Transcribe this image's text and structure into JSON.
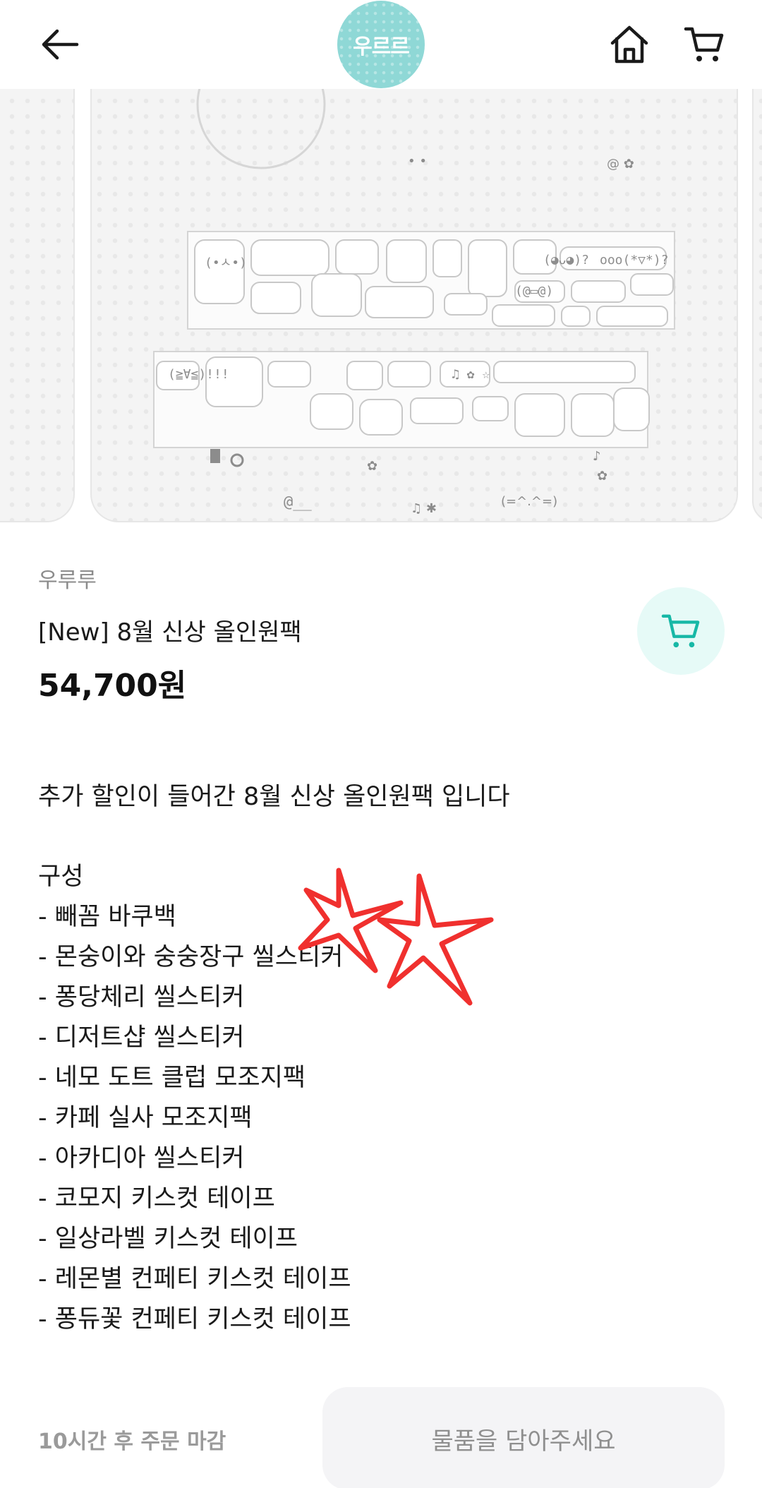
{
  "header": {
    "logo_text": "우르르",
    "back_icon": "arrow-left-icon",
    "home_icon": "home-icon",
    "cart_icon": "cart-icon"
  },
  "product": {
    "brand": "우루루",
    "title": "[New] 8월 신상 올인원팩",
    "price": "54,700원",
    "accent_color": "#17b8a6"
  },
  "description": {
    "intro": "추가 할인이 들어간 8월 신상 올인원팩 입니다",
    "section_title": "구성",
    "items": [
      {
        "text": "- 빼꼼 바쿠백",
        "highlighted": false
      },
      {
        "text": "- 몬숭이와 숭숭장구 씰스티커",
        "highlighted": true
      },
      {
        "text": "- 퐁당체리 씰스티커",
        "highlighted": true
      },
      {
        "text": "- 디저트샵 씰스티커",
        "highlighted": false
      },
      {
        "text": "- 네모 도트 클럽 모조지팩",
        "highlighted": false
      },
      {
        "text": "- 카페 실사 모조지팩",
        "highlighted": false
      },
      {
        "text": "- 아카디아 씰스티커",
        "highlighted": true
      },
      {
        "text": "- 코모지 키스컷 테이프",
        "highlighted": true
      },
      {
        "text": "- 일상라벨 키스컷 테이프",
        "highlighted": false
      },
      {
        "text": "- 레몬별 컨페티 키스컷 테이프",
        "highlighted": true
      },
      {
        "text": "- 퐁듀꽃 컨페티 키스컷 테이프",
        "highlighted": true
      }
    ],
    "highlight_color": "#ffd33d",
    "annotation_color": "#f0302e"
  },
  "footer": {
    "deadline": "10시간 후 주문 마감",
    "cta_label": "물품을 담아주세요"
  }
}
